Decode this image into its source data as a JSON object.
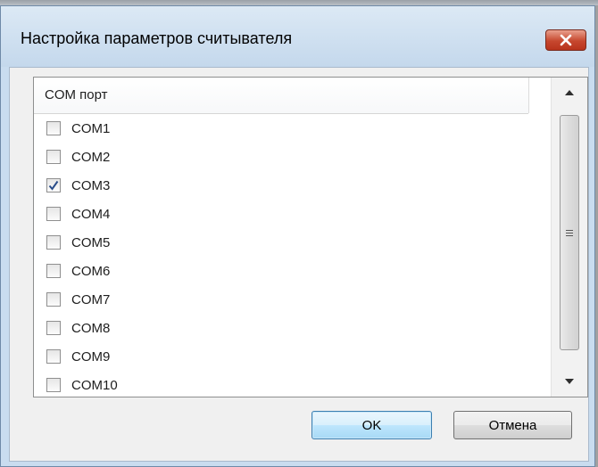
{
  "dialog": {
    "title": "Настройка параметров считывателя"
  },
  "list": {
    "column_header": "COM порт",
    "items": [
      {
        "label": "COM1",
        "checked": false
      },
      {
        "label": "COM2",
        "checked": false
      },
      {
        "label": "COM3",
        "checked": true
      },
      {
        "label": "COM4",
        "checked": false
      },
      {
        "label": "COM5",
        "checked": false
      },
      {
        "label": "COM6",
        "checked": false
      },
      {
        "label": "COM7",
        "checked": false
      },
      {
        "label": "COM8",
        "checked": false
      },
      {
        "label": "COM9",
        "checked": false
      },
      {
        "label": "COM10",
        "checked": false
      }
    ]
  },
  "buttons": {
    "ok": "OK",
    "cancel": "Отмена"
  },
  "colors": {
    "check_mark": "#2a4d8a",
    "close_button": "#c6472e"
  },
  "icons": {
    "close": "close-icon",
    "scroll_up": "chevron-up-icon",
    "scroll_down": "chevron-down-icon",
    "grip": "grip-icon"
  }
}
